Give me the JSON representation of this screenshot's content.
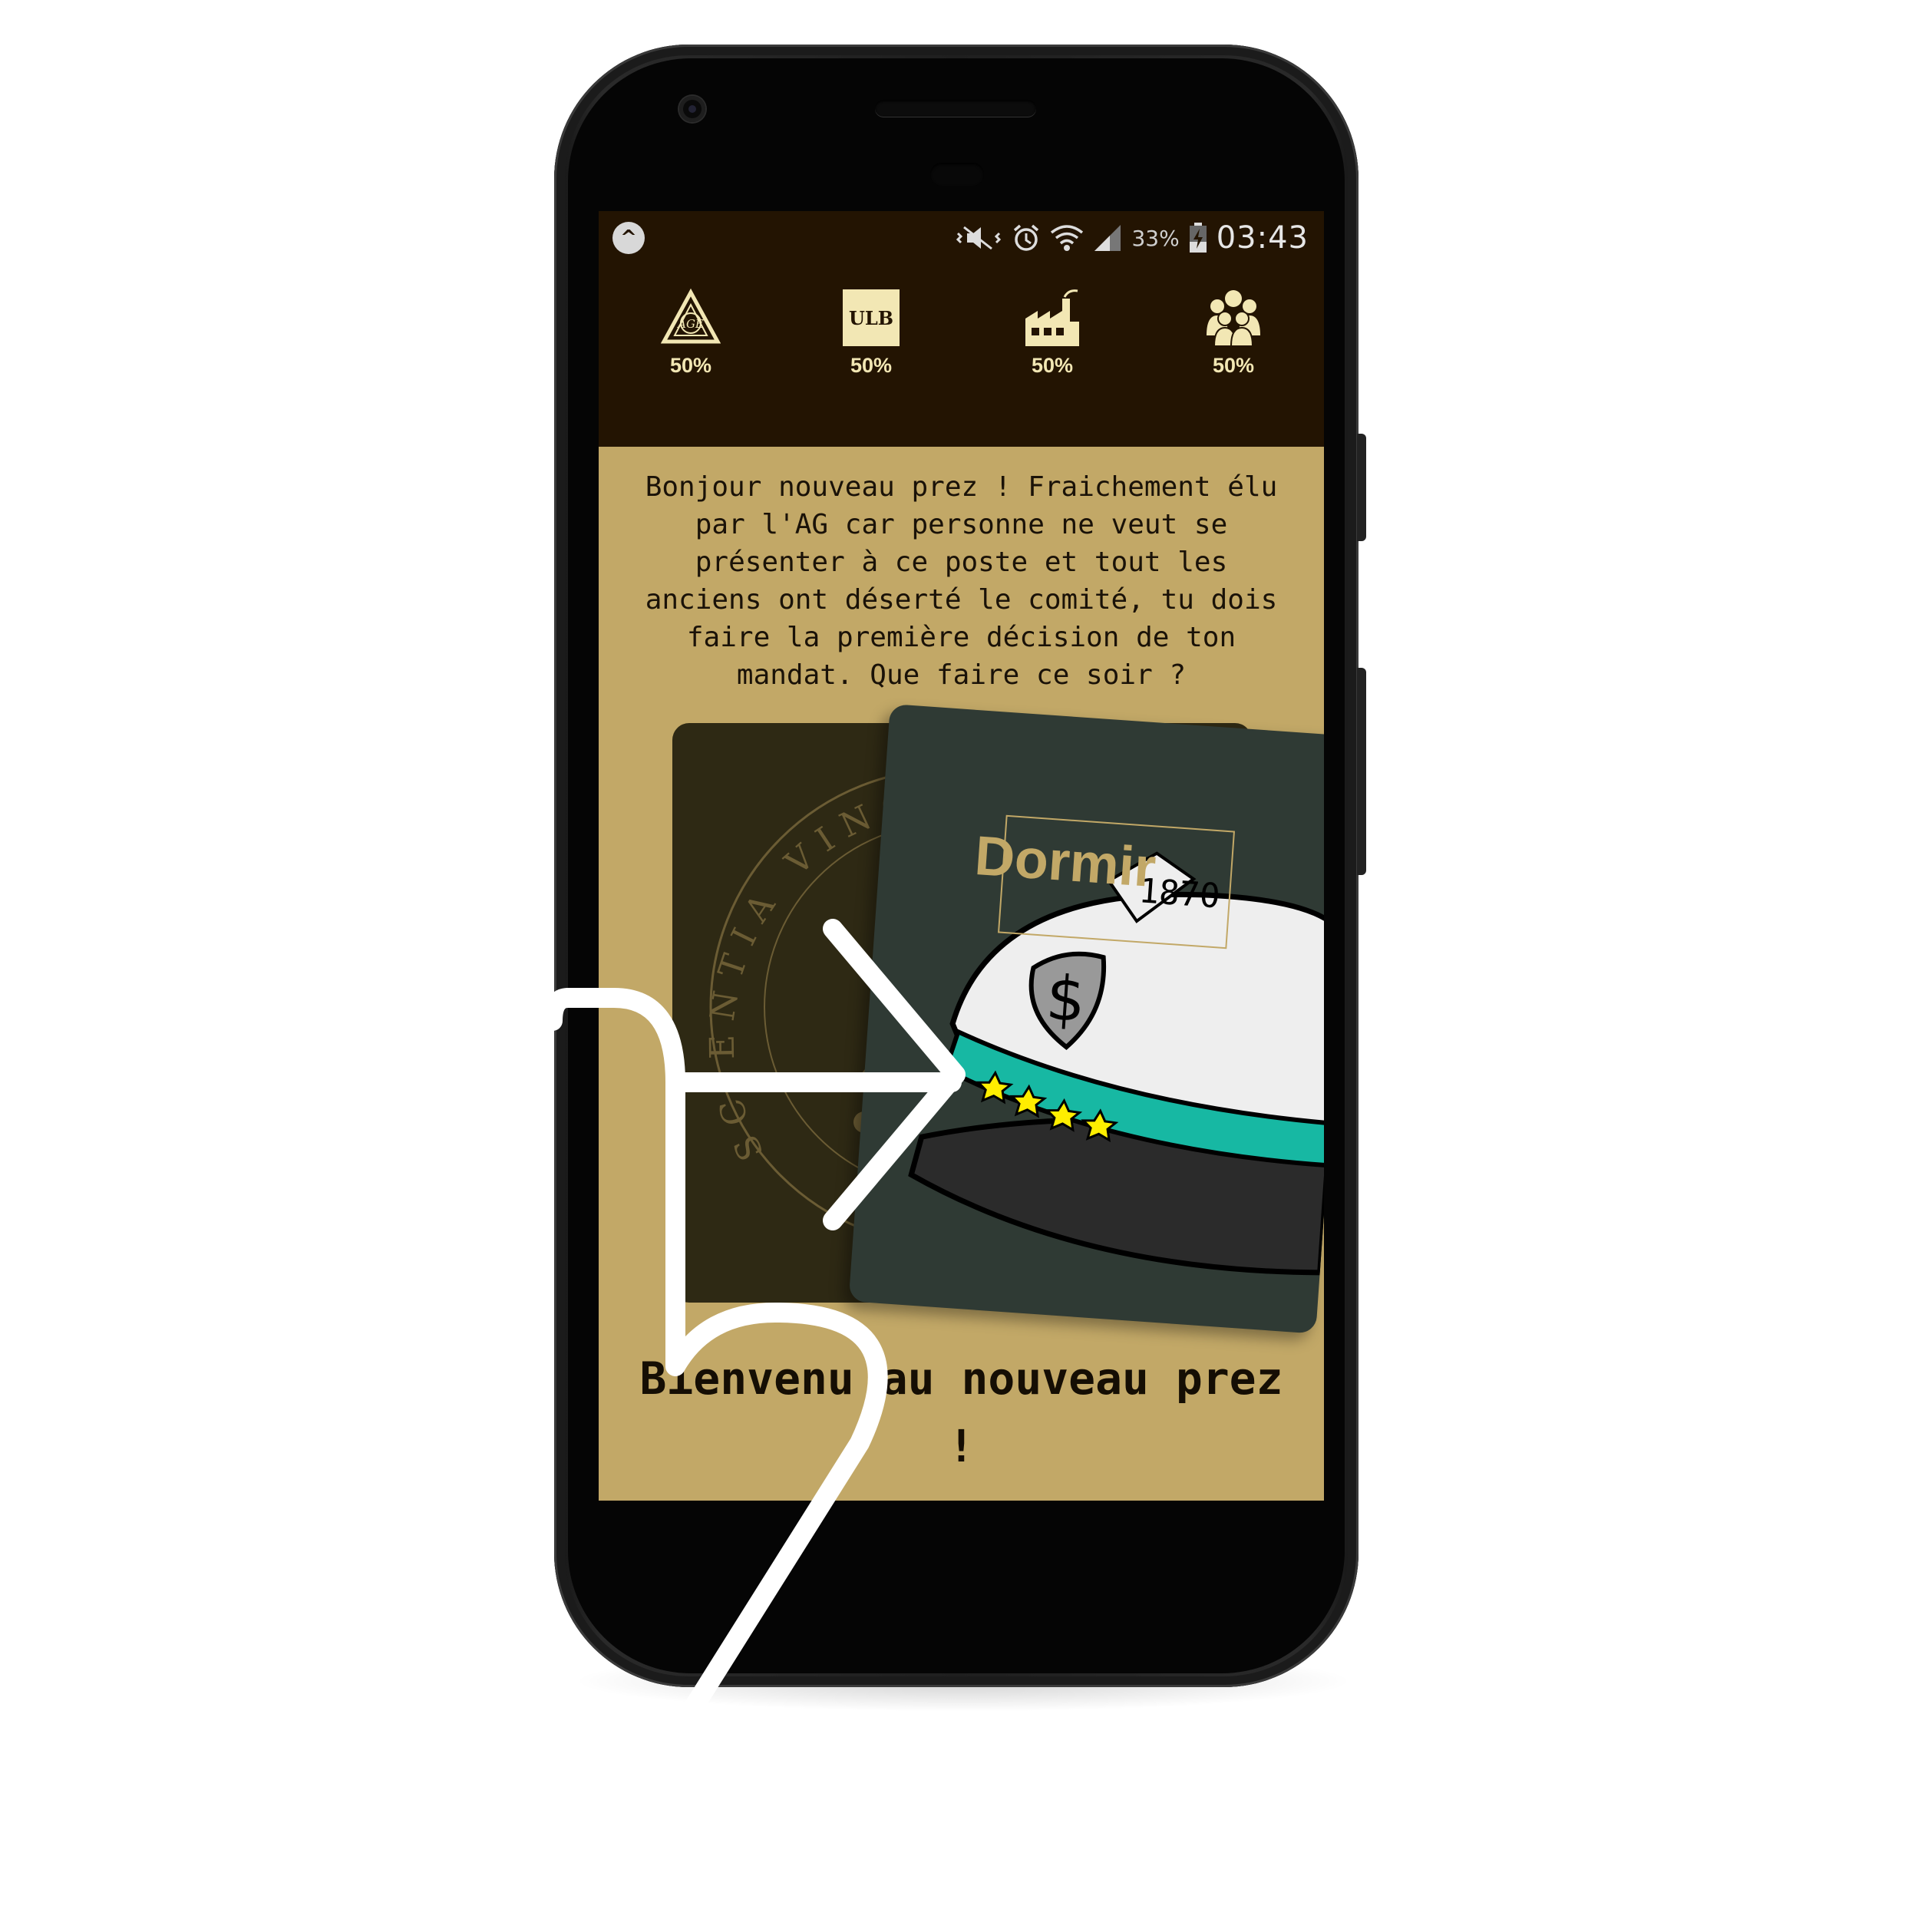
{
  "status_bar": {
    "app_icon": "app-notification-icon",
    "app_glyph": "^",
    "icons": [
      "mute-vibrate-icon",
      "alarm-icon",
      "wifi-icon",
      "signal-icon",
      "battery-charging-icon"
    ],
    "battery_percent": "33%",
    "time": "03:43"
  },
  "stats": [
    {
      "name": "AG",
      "icon": "age-triangle-icon",
      "value": "50%"
    },
    {
      "name": "ULB",
      "icon": "ulb-badge-icon",
      "badge_text": "ULB",
      "value": "50%"
    },
    {
      "name": "Industry",
      "icon": "factory-icon",
      "value": "50%"
    },
    {
      "name": "Students",
      "icon": "people-group-icon",
      "value": "50%"
    }
  ],
  "question": "Bonjour nouveau prez ! Fraichement élu par l'AG car personne ne veut se présenter à ce poste et tout les anciens ont déserté le comité, tu dois faire la première décision de ton mandat. Que faire ce soir ?",
  "card": {
    "seal_text": "SCIENTIA VINCERE TENEBRAS",
    "choice_label": "Dormir",
    "character": "president-cap-illustration",
    "title": "Bienvenu au nouveau prez !"
  },
  "gesture": {
    "icon": "swipe-right-gesture-icon"
  },
  "colors": {
    "header_bg": "#231402",
    "content_bg": "#c2a867",
    "card_back": "#2e2914",
    "card_front": "#2f3a34",
    "stat_text": "#f2e7b4",
    "accent_teal": "#17b8a3"
  }
}
